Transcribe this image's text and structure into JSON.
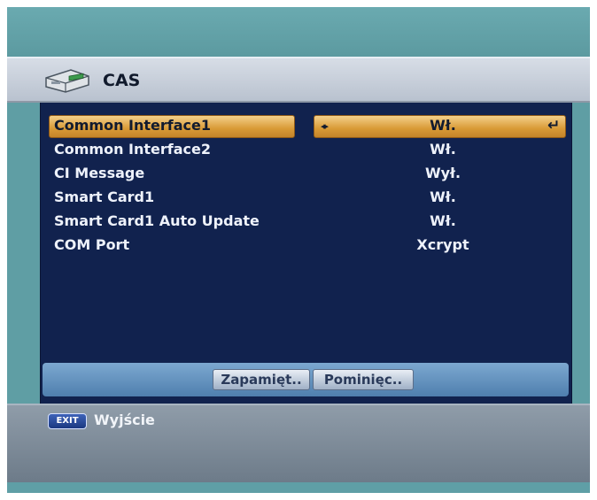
{
  "header": {
    "icon": "smart-card-reader-icon",
    "title": "CAS"
  },
  "menu": {
    "items": [
      {
        "label": "Common Interface1",
        "value": "Wł.",
        "selected": true
      },
      {
        "label": "Common Interface2",
        "value": "Wł."
      },
      {
        "label": "CI Message",
        "value": "Wył."
      },
      {
        "label": "Smart Card1",
        "value": "Wł."
      },
      {
        "label": "Smart Card1 Auto Update",
        "value": "Wł."
      },
      {
        "label": "COM Port",
        "value": "Xcrypt"
      }
    ],
    "selected_indicators": {
      "left": "◂▸",
      "right": "↵"
    }
  },
  "buttons": {
    "save": "Zapamięt..",
    "skip": "Pominięc.."
  },
  "footer": {
    "exit_key": "EXIT",
    "exit_label": "Wyjście"
  },
  "colors": {
    "panel": "#11224e",
    "highlight": "#d89a36",
    "background": "#5f9fa6"
  }
}
